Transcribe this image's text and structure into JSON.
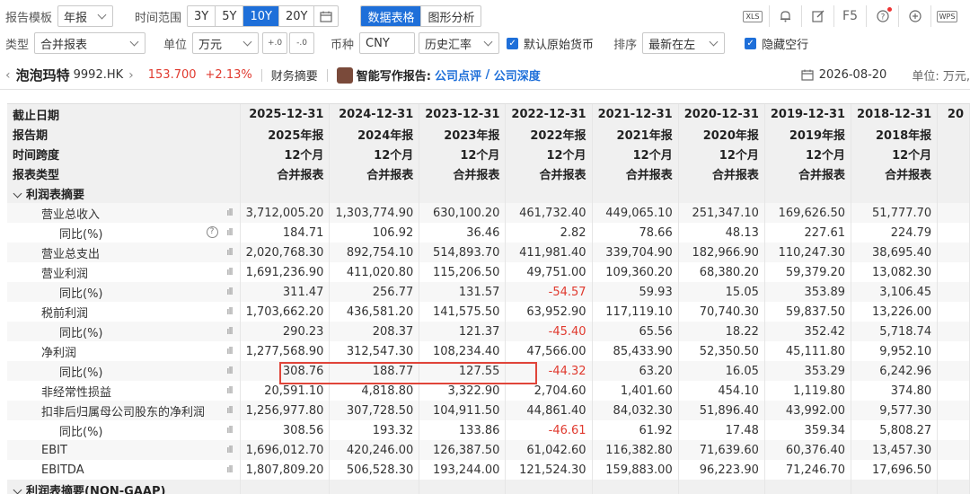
{
  "toolbar1": {
    "template_label": "报告模板",
    "template_value": "年报",
    "range_label": "时间范围",
    "ranges": [
      "3Y",
      "5Y",
      "10Y",
      "20Y"
    ],
    "active_range": "10Y",
    "views": [
      "数据表格",
      "图形分析"
    ],
    "active_view": "数据表格",
    "right_icons": [
      "xls-export-icon",
      "bell-icon",
      "edit-icon",
      "F5",
      "help-icon",
      "plus-circle-icon",
      "wps-icon"
    ],
    "f5_label": "F5",
    "xls_label": "XLS",
    "wps_label": "WPS"
  },
  "toolbar2": {
    "type_label": "类型",
    "type_value": "合并报表",
    "unit_label": "单位",
    "unit_value": "万元",
    "decimal_inc": "+.0",
    "decimal_dec": "-.0",
    "currency_label": "币种",
    "currency_value": "CNY",
    "rate_value": "历史汇率",
    "default_currency_label": "默认原始货币",
    "sort_label": "排序",
    "sort_value": "最新在左",
    "hide_empty_label": "隐藏空行"
  },
  "stock": {
    "name": "泡泡玛特",
    "code": "9992.HK",
    "price": "153.700",
    "change": "+2.13%",
    "tab": "财务摘要",
    "ai_label": "智能写作报告:",
    "link1": "公司点评",
    "link_sep": " / ",
    "link2": "公司深度",
    "date": "2026-08-20",
    "unit": "单位: 万元,"
  },
  "table": {
    "header_rows": [
      {
        "label": "截止日期",
        "cells": [
          "2025-12-31",
          "2024-12-31",
          "2023-12-31",
          "2022-12-31",
          "2021-12-31",
          "2020-12-31",
          "2019-12-31",
          "2018-12-31",
          "20"
        ]
      },
      {
        "label": "报告期",
        "cells": [
          "2025年报",
          "2024年报",
          "2023年报",
          "2022年报",
          "2021年报",
          "2020年报",
          "2019年报",
          "2018年报",
          ""
        ]
      },
      {
        "label": "时间跨度",
        "cells": [
          "12个月",
          "12个月",
          "12个月",
          "12个月",
          "12个月",
          "12个月",
          "12个月",
          "12个月",
          ""
        ]
      },
      {
        "label": "报表类型",
        "cells": [
          "合并报表",
          "合并报表",
          "合并报表",
          "合并报表",
          "合并报表",
          "合并报表",
          "合并报表",
          "合并报表",
          ""
        ]
      }
    ],
    "section1": "利润表摘要",
    "rows": [
      {
        "label": "营业总收入",
        "indent": 1,
        "help": false,
        "cells": [
          "3,712,005.20",
          "1,303,774.90",
          "630,100.20",
          "461,732.40",
          "449,065.10",
          "251,347.10",
          "169,626.50",
          "51,777.70"
        ]
      },
      {
        "label": "同比(%)",
        "indent": 2,
        "help": true,
        "cells": [
          "184.71",
          "106.92",
          "36.46",
          "2.82",
          "78.66",
          "48.13",
          "227.61",
          "224.79"
        ]
      },
      {
        "label": "营业总支出",
        "indent": 1,
        "help": false,
        "cells": [
          "2,020,768.30",
          "892,754.10",
          "514,893.70",
          "411,981.40",
          "339,704.90",
          "182,966.90",
          "110,247.30",
          "38,695.40"
        ]
      },
      {
        "label": "营业利润",
        "indent": 1,
        "help": false,
        "cells": [
          "1,691,236.90",
          "411,020.80",
          "115,206.50",
          "49,751.00",
          "109,360.20",
          "68,380.20",
          "59,379.20",
          "13,082.30"
        ]
      },
      {
        "label": "同比(%)",
        "indent": 2,
        "help": false,
        "cells": [
          "311.47",
          "256.77",
          "131.57",
          "-54.57",
          "59.93",
          "15.05",
          "353.89",
          "3,106.45"
        ]
      },
      {
        "label": "税前利润",
        "indent": 1,
        "help": false,
        "cells": [
          "1,703,662.20",
          "436,581.20",
          "141,575.50",
          "63,952.90",
          "117,119.10",
          "70,740.30",
          "59,837.50",
          "13,226.00"
        ]
      },
      {
        "label": "同比(%)",
        "indent": 2,
        "help": false,
        "cells": [
          "290.23",
          "208.37",
          "121.37",
          "-45.40",
          "65.56",
          "18.22",
          "352.42",
          "5,718.74"
        ]
      },
      {
        "label": "净利润",
        "indent": 1,
        "help": false,
        "cells": [
          "1,277,568.90",
          "312,547.30",
          "108,234.40",
          "47,566.00",
          "85,433.90",
          "52,350.50",
          "45,111.80",
          "9,952.10"
        ]
      },
      {
        "label": "同比(%)",
        "indent": 2,
        "help": false,
        "cells": [
          "308.76",
          "188.77",
          "127.55",
          "-44.32",
          "63.20",
          "16.05",
          "353.29",
          "6,242.96"
        ]
      },
      {
        "label": "非经常性损益",
        "indent": 1,
        "help": false,
        "cells": [
          "20,591.10",
          "4,818.80",
          "3,322.90",
          "2,704.60",
          "1,401.60",
          "454.10",
          "1,119.80",
          "374.80"
        ]
      },
      {
        "label": "扣非后归属母公司股东的净利润",
        "indent": 1,
        "help": false,
        "cells": [
          "1,256,977.80",
          "307,728.50",
          "104,911.50",
          "44,861.40",
          "84,032.30",
          "51,896.40",
          "43,992.00",
          "9,577.30"
        ]
      },
      {
        "label": "同比(%)",
        "indent": 2,
        "help": false,
        "cells": [
          "308.56",
          "193.32",
          "133.86",
          "-46.61",
          "61.92",
          "17.48",
          "359.34",
          "5,808.27"
        ]
      },
      {
        "label": "EBIT",
        "indent": 1,
        "help": false,
        "cells": [
          "1,696,012.70",
          "420,246.00",
          "126,387.50",
          "61,042.60",
          "116,382.80",
          "71,639.60",
          "60,376.40",
          "13,457.30"
        ]
      },
      {
        "label": "EBITDA",
        "indent": 1,
        "help": false,
        "cells": [
          "1,807,809.20",
          "506,528.30",
          "193,244.00",
          "121,524.30",
          "159,883.00",
          "96,223.90",
          "71,246.70",
          "17,696.50"
        ]
      }
    ],
    "section2": "利润表摘要(NON-GAAP)",
    "negative_color": "#e03a2f"
  }
}
